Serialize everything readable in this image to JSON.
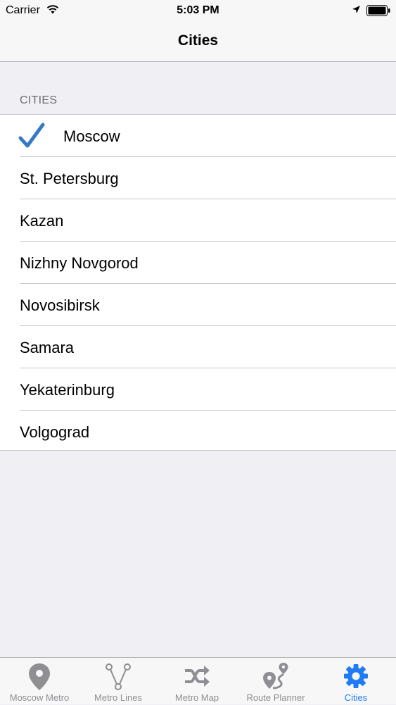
{
  "status_bar": {
    "carrier": "Carrier",
    "time": "5:03 PM",
    "icons": [
      "wifi-icon",
      "location-arrow-icon",
      "battery-icon"
    ]
  },
  "nav": {
    "title": "Cities"
  },
  "section": {
    "header": "CITIES"
  },
  "cities": [
    {
      "name": "Moscow",
      "selected": true
    },
    {
      "name": "St. Petersburg",
      "selected": false
    },
    {
      "name": "Kazan",
      "selected": false
    },
    {
      "name": "Nizhny Novgorod",
      "selected": false
    },
    {
      "name": "Novosibirsk",
      "selected": false
    },
    {
      "name": "Samara",
      "selected": false
    },
    {
      "name": "Yekaterinburg",
      "selected": false
    },
    {
      "name": "Volgograd",
      "selected": false
    }
  ],
  "tabs": [
    {
      "label": "Moscow Metro",
      "icon": "map-pin-icon",
      "active": false
    },
    {
      "label": "Metro Lines",
      "icon": "metro-lines-icon",
      "active": false
    },
    {
      "label": "Metro Map",
      "icon": "shuffle-icon",
      "active": false
    },
    {
      "label": "Route Planner",
      "icon": "route-planner-icon",
      "active": false
    },
    {
      "label": "Cities",
      "icon": "gear-icon",
      "active": true
    }
  ],
  "colors": {
    "accent": "#1f7bf5",
    "checkmark": "#3478c8",
    "inactive_tab": "#8e8e93",
    "background": "#efeff4"
  }
}
